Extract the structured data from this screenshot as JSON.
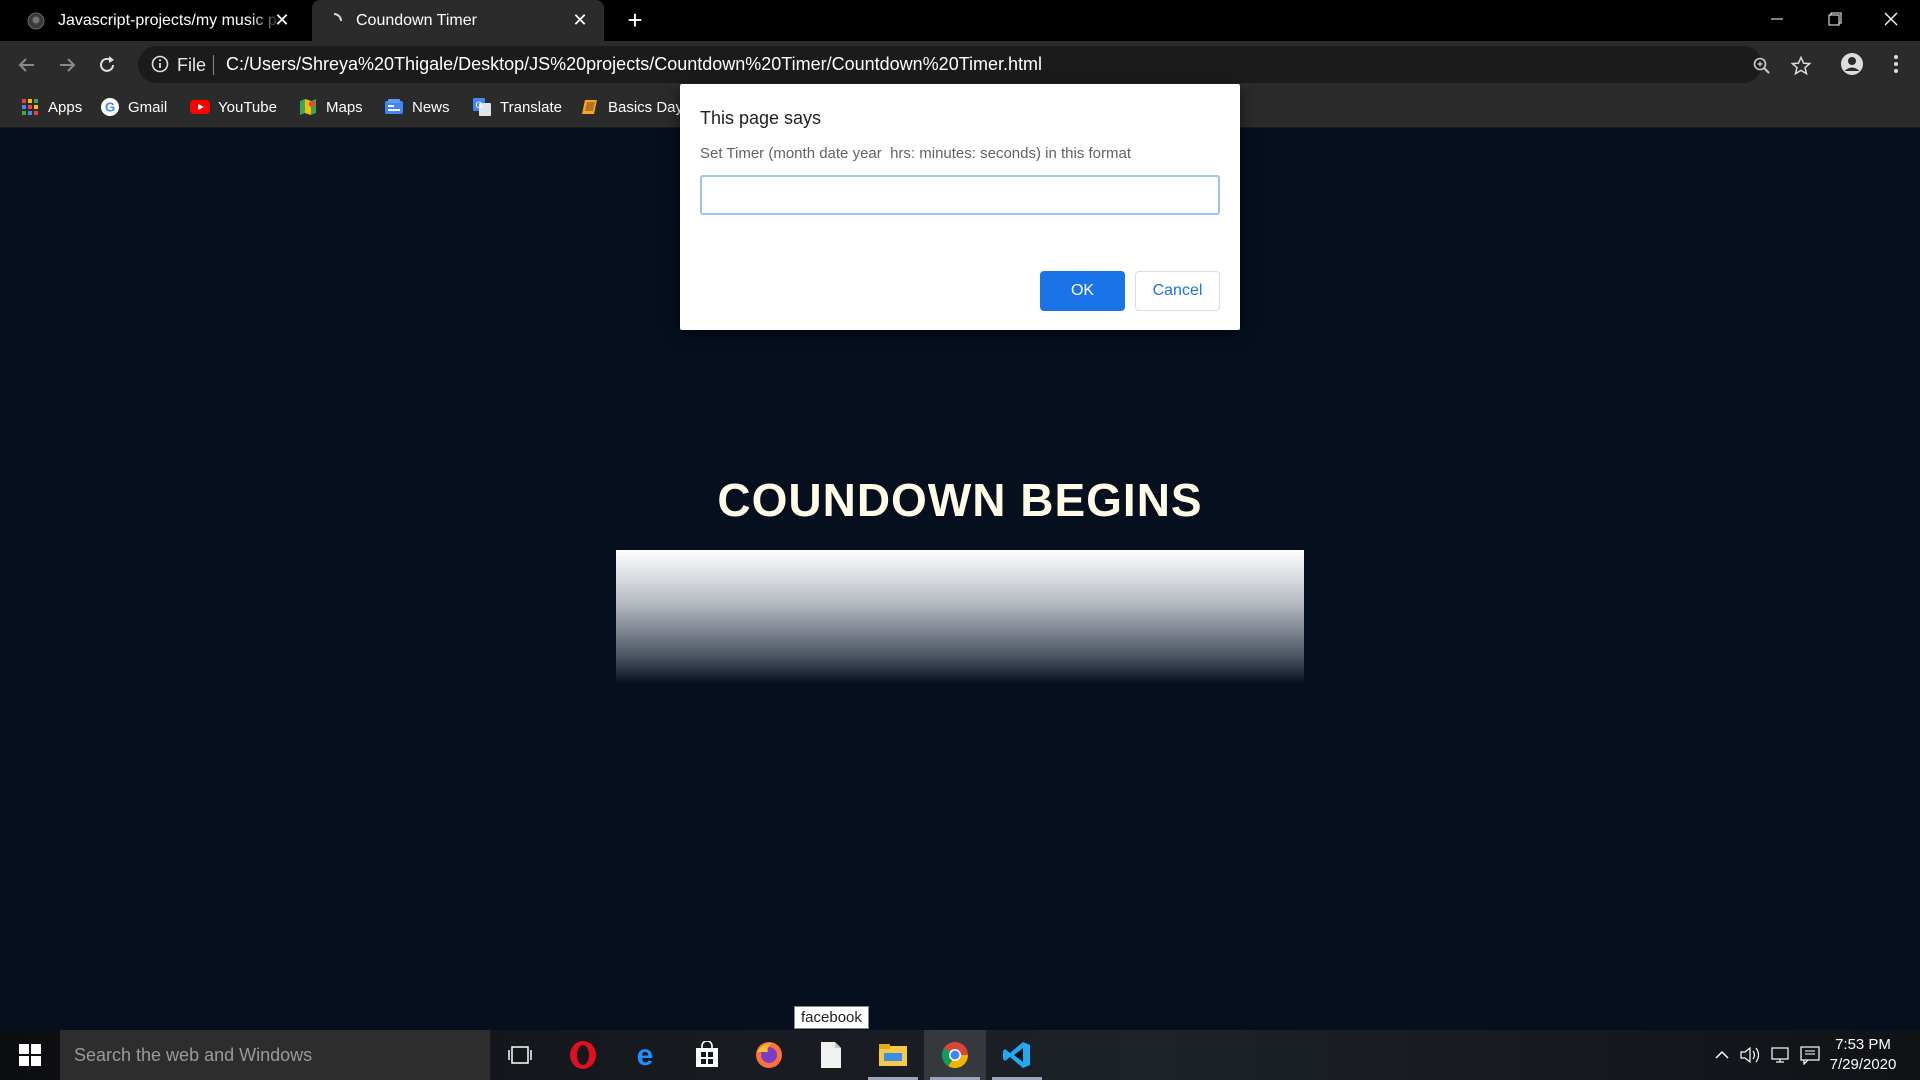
{
  "browser": {
    "tabs": [
      {
        "title": "Javascript-projects/my music pla",
        "icon": "github-icon"
      },
      {
        "title": "Coundown Timer",
        "icon": "loading-spinner-icon"
      }
    ],
    "address": {
      "scheme_label": "File",
      "url": "C:/Users/Shreya%20Thigale/Desktop/JS%20projects/Countdown%20Timer/Countdown%20Timer.html"
    },
    "bookmarks": [
      {
        "label": "Apps",
        "icon": "apps-grid-icon"
      },
      {
        "label": "Gmail",
        "icon": "google-icon"
      },
      {
        "label": "YouTube",
        "icon": "youtube-icon"
      },
      {
        "label": "Maps",
        "icon": "maps-icon"
      },
      {
        "label": "News",
        "icon": "news-icon"
      },
      {
        "label": "Translate",
        "icon": "translate-icon"
      },
      {
        "label": "Basics Day",
        "icon": "book-icon"
      }
    ]
  },
  "dialog": {
    "title": "This page says",
    "message": "Set Timer (month date year  hrs: minutes: seconds) in this format",
    "input_value": "",
    "ok_label": "OK",
    "cancel_label": "Cancel"
  },
  "page": {
    "heading": "COUNDOWN BEGINS"
  },
  "taskbar": {
    "search_placeholder": "Search the web and Windows",
    "tooltip": "facebook",
    "apps": [
      "task-view",
      "opera",
      "edge",
      "store",
      "firefox",
      "notepad",
      "file-explorer",
      "chrome",
      "vscode"
    ],
    "time": "7:53 PM",
    "date": "7/29/2020"
  },
  "colors": {
    "page_bg": "#050f1e",
    "heading": "#fffbe6",
    "accent": "#1a73e8",
    "chrome_dark": "#2b2b2b"
  }
}
